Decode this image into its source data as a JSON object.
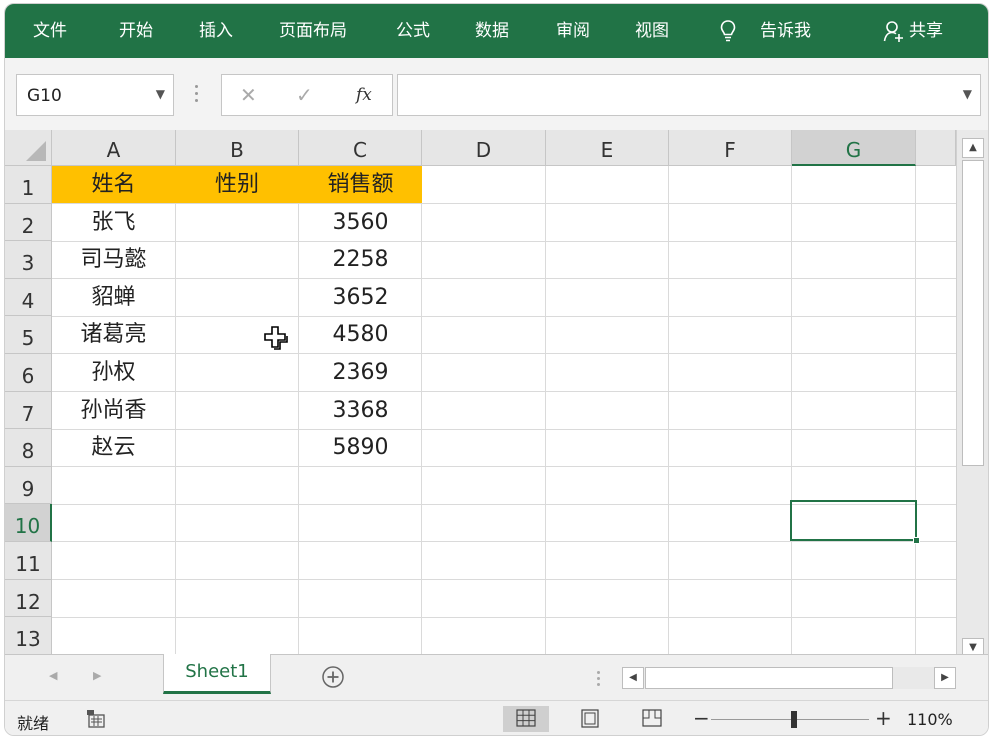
{
  "ribbon": {
    "tabs": [
      "文件",
      "开始",
      "插入",
      "页面布局",
      "公式",
      "数据",
      "审阅",
      "视图"
    ],
    "tell_me": "告诉我",
    "share": "共享"
  },
  "formula_bar": {
    "name_box": "G10",
    "formula_value": ""
  },
  "sheet": {
    "columns": [
      "A",
      "B",
      "C",
      "D",
      "E",
      "F",
      "G"
    ],
    "selected_column": "G",
    "rows": [
      "1",
      "2",
      "3",
      "4",
      "5",
      "6",
      "7",
      "8",
      "9",
      "10",
      "11",
      "12",
      "13"
    ],
    "selected_row": "10",
    "headers": [
      "姓名",
      "性别",
      "销售额"
    ],
    "data": [
      {
        "name": "张飞",
        "gender": "",
        "sales": "3560"
      },
      {
        "name": "司马懿",
        "gender": "",
        "sales": "2258"
      },
      {
        "name": "貂蝉",
        "gender": "",
        "sales": "3652"
      },
      {
        "name": "诸葛亮",
        "gender": "",
        "sales": "4580"
      },
      {
        "name": "孙权",
        "gender": "",
        "sales": "2369"
      },
      {
        "name": "孙尚香",
        "gender": "",
        "sales": "3368"
      },
      {
        "name": "赵云",
        "gender": "",
        "sales": "5890"
      }
    ],
    "header_fill": "#ffc000",
    "accent": "#217346"
  },
  "tabs": {
    "sheet_name": "Sheet1"
  },
  "status": {
    "ready": "就绪",
    "zoom": "110%"
  }
}
